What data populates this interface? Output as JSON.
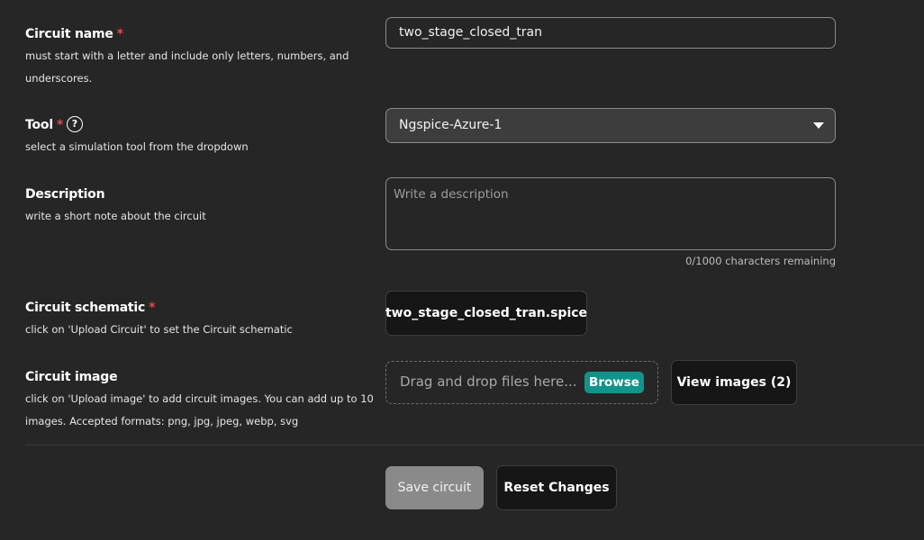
{
  "circuit_name": {
    "label": "Circuit name",
    "required_mark": "*",
    "help_line1": "must start with a letter and include only letters, numbers, and",
    "help_line2": "underscores.",
    "value": "two_stage_closed_tran"
  },
  "tool": {
    "label": "Tool",
    "required_mark": "*",
    "help_icon_glyph": "?",
    "help": "select a simulation tool from the dropdown",
    "selected": "Ngspice-Azure-1"
  },
  "description": {
    "label": "Description",
    "help": "write a short note about the circuit",
    "placeholder": "Write a description",
    "counter": "0/1000 characters remaining"
  },
  "schematic": {
    "label": "Circuit schematic",
    "required_mark": "*",
    "help": "click on 'Upload Circuit' to set the Circuit schematic",
    "file_button": "two_stage_closed_tran.spice"
  },
  "image": {
    "label": "Circuit image",
    "help_line1": "click on 'Upload image' to add circuit images. You can add up to 10",
    "help_line2": "images. Accepted formats: png, jpg, jpeg, webp, svg",
    "dropzone_text": "Drag and drop files here...",
    "browse_label": "Browse",
    "view_button": "View images (2)"
  },
  "actions": {
    "save_label": "Save circuit",
    "reset_label": "Reset Changes"
  },
  "colors": {
    "background": "#262626",
    "required": "#e5484d",
    "browse": "#10948c",
    "disabled_button": "#8a8a8a"
  }
}
